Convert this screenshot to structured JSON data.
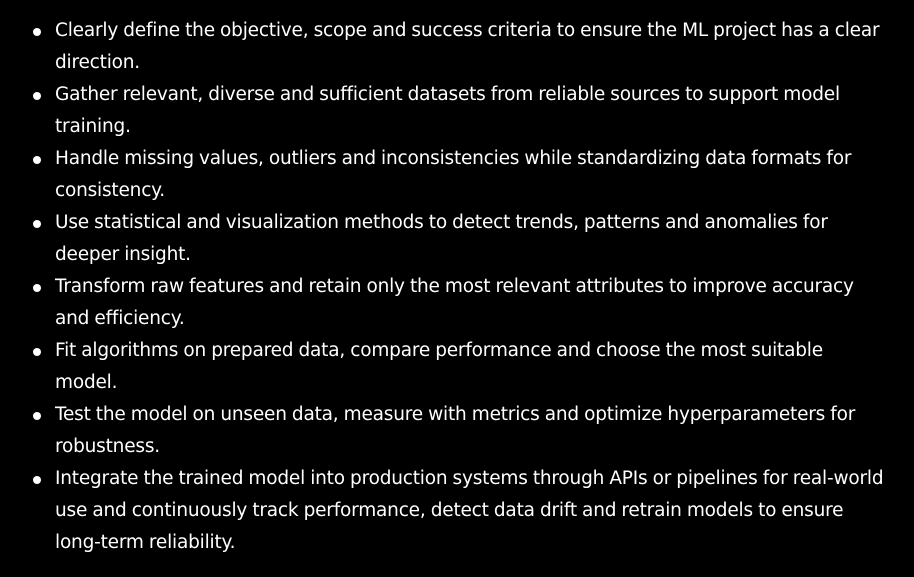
{
  "items": [
    {
      "text": "Clearly define the objective, scope and success criteria to ensure the ML project has a clear direction."
    },
    {
      "text": "Gather relevant, diverse and sufficient datasets from reliable sources to support model training."
    },
    {
      "text": "Handle missing values, outliers and inconsistencies while standardizing data formats for consistency."
    },
    {
      "text": "Use statistical and visualization methods to detect trends, patterns and anomalies for deeper insight."
    },
    {
      "text": "Transform raw features and retain only the most relevant attributes to improve accuracy and efficiency."
    },
    {
      "text": "Fit algorithms on prepared data, compare performance and choose the most suitable model."
    },
    {
      "text": "Test the model on unseen data, measure with metrics and optimize hyperparameters for robustness."
    },
    {
      "text": "Integrate the trained model into production systems through APIs or pipelines for real-world use and continuously track performance, detect data drift and retrain models to ensure long-term reliability."
    }
  ]
}
